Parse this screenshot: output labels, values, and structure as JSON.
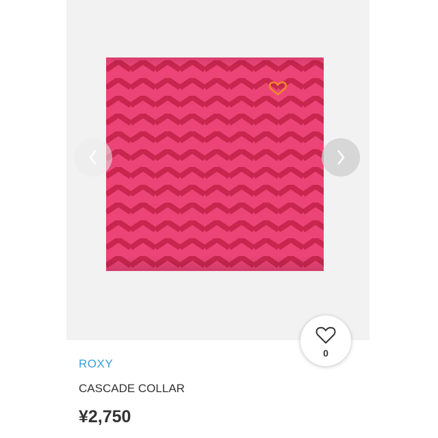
{
  "product": {
    "brand": "ROXY",
    "name": "CASCADE COLLAR",
    "price": "¥2,750",
    "image_icon": "product-photo-icon"
  },
  "gallery": {
    "prev_icon": "chevron-left-icon",
    "next_icon": "chevron-right-icon"
  },
  "like": {
    "icon": "heart-icon",
    "count": "0"
  },
  "colors": {
    "brand_link": "#3a9ed8",
    "text": "#333333",
    "product_pink": "#e83a6b",
    "product_stripe": "#c8264f",
    "image_bg": "#f2f2f2"
  }
}
